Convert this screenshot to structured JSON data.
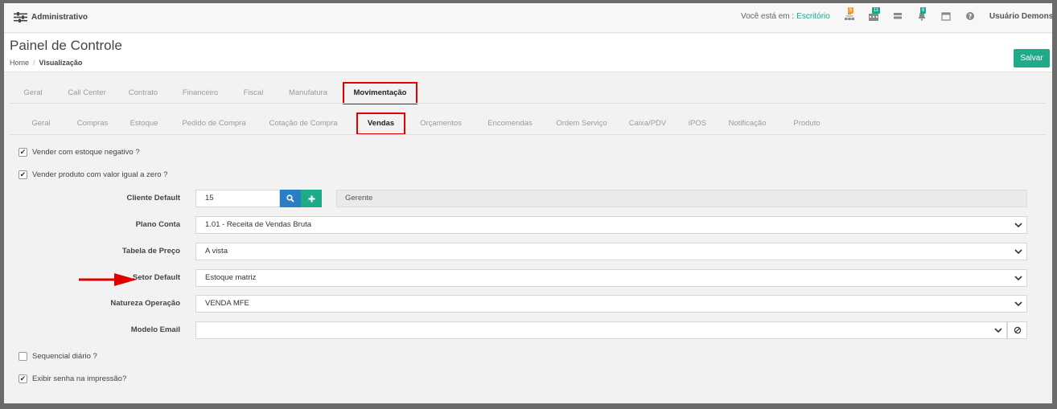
{
  "app": {
    "title": "Administrativo"
  },
  "topbar": {
    "location_prefix": "Você está em :",
    "location": "Escritório",
    "badges": {
      "sitemap": "5",
      "calendar": "11",
      "bell": "8"
    },
    "user": "Usuário Demonstração",
    "colors": {
      "accent": "#1ba58b",
      "orange_badge": "#f0a030",
      "green_badge": "#1ba58b"
    }
  },
  "header": {
    "title": "Painel de Controle",
    "breadcrumb": {
      "home": "Home",
      "separator": "/",
      "current": "Visualização"
    },
    "save_label": "Salvar"
  },
  "main_tabs": [
    {
      "label": "Geral"
    },
    {
      "label": "Call Center"
    },
    {
      "label": "Contrato"
    },
    {
      "label": "Financeiro"
    },
    {
      "label": "Fiscal"
    },
    {
      "label": "Manufatura"
    },
    {
      "label": "Movimentação",
      "active": true
    }
  ],
  "sub_tabs": [
    {
      "label": "Geral"
    },
    {
      "label": "Compras"
    },
    {
      "label": "Estoque"
    },
    {
      "label": "Pedido de Compra"
    },
    {
      "label": "Cotação de Compra"
    },
    {
      "label": "Vendas",
      "active": true
    },
    {
      "label": "Orçamentos"
    },
    {
      "label": "Encomendas"
    },
    {
      "label": "Ordem Serviço"
    },
    {
      "label": "Caixa/PDV"
    },
    {
      "label": "iPOS"
    },
    {
      "label": "Notificação"
    },
    {
      "label": "Produto"
    }
  ],
  "checks": {
    "estoque_negativo": {
      "label": "Vender com estoque negativo ?",
      "checked": true
    },
    "valor_zero": {
      "label": "Vender produto com valor igual a zero ?",
      "checked": true
    },
    "sequencial": {
      "label": "Sequencial diário ?",
      "checked": false
    },
    "exibir_senha": {
      "label": "Exibir senha na impressão?",
      "checked": true
    }
  },
  "form": {
    "cliente": {
      "label": "Cliente Default",
      "value": "15",
      "name": "Gerente"
    },
    "plano_conta": {
      "label": "Plano Conta",
      "value": "1.01 - Receita de Vendas Bruta"
    },
    "tabela_preco": {
      "label": "Tabela de Preço",
      "value": "A vista"
    },
    "setor": {
      "label": "Setor Default",
      "value": "Estoque matriz"
    },
    "natureza": {
      "label": "Natureza Operação",
      "value": "VENDA MFE"
    },
    "modelo_email": {
      "label": "Modelo Email",
      "value": ""
    }
  },
  "icons": {
    "brand": "sliders-icon",
    "search": "search-icon",
    "add": "plus-icon",
    "select": "chevron-down-icon",
    "clear": "ban-icon",
    "annotation": "red-arrow-icon"
  }
}
